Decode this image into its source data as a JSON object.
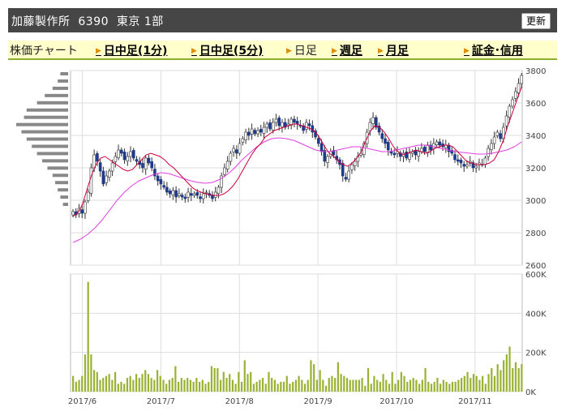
{
  "header": {
    "title": "加藤製作所  6390  東京 1部",
    "refresh_label": "更新"
  },
  "nav": {
    "label": "株価チャート",
    "items": [
      {
        "label": "日中足(1分)",
        "active": false
      },
      {
        "label": "日中足(5分)",
        "active": false
      },
      {
        "label": "日足",
        "active": true
      },
      {
        "label": "週足",
        "active": false
      },
      {
        "label": "月足",
        "active": false
      }
    ],
    "right_link": "証金･信用"
  },
  "colors": {
    "up_candle": "#ffffff",
    "down_candle": "#1f3a8a",
    "ma_short": "#d0003c",
    "ma_long": "#e040e0",
    "volume": "#99b233",
    "volume_profile": "#888888",
    "grid": "#dddddd",
    "nav_background": "#ffffcc",
    "title_background": "#464646"
  },
  "chart_data": [
    {
      "type": "candlestick",
      "price_axis": {
        "min": 2600,
        "max": 3800,
        "ticks": [
          2600,
          2800,
          3000,
          3200,
          3400,
          3600,
          3800
        ]
      },
      "x_labels": [
        "2017/6",
        "2017/7",
        "2017/8",
        "2017/9",
        "2017/10",
        "2017/11"
      ],
      "close_series": [
        2930,
        2910,
        2950,
        2920,
        2990,
        3050,
        3200,
        3280,
        3240,
        3180,
        3100,
        3150,
        3180,
        3230,
        3270,
        3310,
        3290,
        3250,
        3270,
        3300,
        3260,
        3240,
        3220,
        3200,
        3260,
        3230,
        3200,
        3150,
        3120,
        3100,
        3080,
        3050,
        3040,
        3060,
        3020,
        3040,
        3020,
        3010,
        3050,
        3030,
        3040,
        3030,
        3010,
        3040,
        3050,
        3030,
        3010,
        3050,
        3080,
        3150,
        3200,
        3240,
        3290,
        3320,
        3290,
        3350,
        3380,
        3420,
        3400,
        3440,
        3410,
        3430,
        3420,
        3450,
        3470,
        3440,
        3480,
        3500,
        3460,
        3480,
        3450,
        3470,
        3500,
        3480,
        3470,
        3460,
        3430,
        3480,
        3460,
        3420,
        3390,
        3350,
        3300,
        3240,
        3270,
        3300,
        3280,
        3250,
        3220,
        3150,
        3130,
        3180,
        3220,
        3240,
        3270,
        3290,
        3350,
        3420,
        3480,
        3510,
        3450,
        3420,
        3380,
        3350,
        3310,
        3290,
        3280,
        3300,
        3270,
        3290,
        3260,
        3290,
        3300,
        3280,
        3300,
        3320,
        3300,
        3340,
        3310,
        3350,
        3360,
        3340,
        3330,
        3340,
        3300,
        3290,
        3250,
        3240,
        3230,
        3210,
        3220,
        3240,
        3200,
        3210,
        3230,
        3220,
        3260,
        3320,
        3350,
        3390,
        3420,
        3380,
        3450,
        3520,
        3580,
        3620,
        3670,
        3720,
        3770
      ],
      "ma_short_series": [
        2900,
        2920,
        2970,
        3060,
        3150,
        3220,
        3260,
        3270,
        3250,
        3230,
        3210,
        3190,
        3180,
        3190,
        3220,
        3250,
        3280,
        3290,
        3280,
        3270,
        3250,
        3220,
        3200,
        3170,
        3140,
        3110,
        3080,
        3060,
        3050,
        3040,
        3035,
        3030,
        3030,
        3040,
        3060,
        3090,
        3130,
        3180,
        3230,
        3280,
        3320,
        3350,
        3390,
        3410,
        3430,
        3440,
        3450,
        3460,
        3470,
        3470,
        3460,
        3450,
        3440,
        3420,
        3380,
        3330,
        3290,
        3270,
        3240,
        3220,
        3210,
        3230,
        3260,
        3300,
        3370,
        3430,
        3460,
        3450,
        3420,
        3380,
        3330,
        3300,
        3280,
        3290,
        3300,
        3310,
        3300,
        3290,
        3300,
        3320,
        3330,
        3340,
        3340,
        3330,
        3300,
        3270,
        3240,
        3230,
        3220,
        3220,
        3220,
        3230,
        3250,
        3300,
        3370,
        3460,
        3540,
        3620,
        3700
      ],
      "ma_long_series": [
        2740,
        2760,
        2790,
        2830,
        2880,
        2940,
        3000,
        3050,
        3090,
        3120,
        3140,
        3160,
        3170,
        3165,
        3150,
        3135,
        3120,
        3110,
        3105,
        3110,
        3130,
        3160,
        3200,
        3250,
        3290,
        3330,
        3360,
        3380,
        3385,
        3380,
        3370,
        3350,
        3330,
        3310,
        3300,
        3300,
        3310,
        3320,
        3330,
        3330,
        3320,
        3310,
        3300,
        3300,
        3310,
        3320,
        3330,
        3340,
        3340,
        3330,
        3320,
        3310,
        3300,
        3295,
        3290,
        3285,
        3285,
        3290,
        3300,
        3310,
        3330,
        3360
      ]
    },
    {
      "type": "bar",
      "title": "volume",
      "axis": {
        "min": 0,
        "max": 600000,
        "ticks": [
          "0K",
          "200K",
          "400K",
          "600K"
        ]
      },
      "values": [
        80000,
        50000,
        60000,
        80000,
        190000,
        560000,
        190000,
        110000,
        100000,
        60000,
        70000,
        80000,
        90000,
        60000,
        100000,
        40000,
        50000,
        40000,
        70000,
        80000,
        60000,
        90000,
        70000,
        90000,
        110000,
        90000,
        70000,
        60000,
        110000,
        80000,
        60000,
        40000,
        60000,
        70000,
        130000,
        50000,
        70000,
        60000,
        70000,
        60000,
        50000,
        70000,
        50000,
        60000,
        40000,
        50000,
        130000,
        120000,
        120000,
        60000,
        100000,
        70000,
        90000,
        60000,
        40000,
        100000,
        50000,
        160000,
        90000,
        100000,
        40000,
        50000,
        60000,
        70000,
        40000,
        100000,
        70000,
        60000,
        40000,
        50000,
        50000,
        80000,
        40000,
        50000,
        60000,
        80000,
        60000,
        40000,
        60000,
        160000,
        140000,
        60000,
        110000,
        60000,
        30000,
        70000,
        80000,
        70000,
        150000,
        90000,
        80000,
        70000,
        60000,
        60000,
        60000,
        60000,
        70000,
        30000,
        120000,
        40000,
        80000,
        60000,
        50000,
        90000,
        60000,
        40000,
        100000,
        40000,
        60000,
        100000,
        80000,
        50000,
        60000,
        70000,
        60000,
        40000,
        60000,
        120000,
        50000,
        40000,
        50000,
        70000,
        40000,
        60000,
        50000,
        40000,
        50000,
        50000,
        60000,
        70000,
        80000,
        100000,
        70000,
        90000,
        80000,
        60000,
        80000,
        40000,
        90000,
        120000,
        80000,
        140000,
        110000,
        160000,
        190000,
        230000,
        120000,
        150000,
        120000,
        140000
      ]
    }
  ],
  "volume_profile": [
    0.15,
    0.2,
    0.3,
    0.45,
    0.6,
    0.8,
    0.85,
    1.0,
    0.9,
    0.8,
    0.7,
    0.6,
    0.5,
    0.4,
    0.3,
    0.25,
    0.2,
    0.15,
    0.1
  ]
}
